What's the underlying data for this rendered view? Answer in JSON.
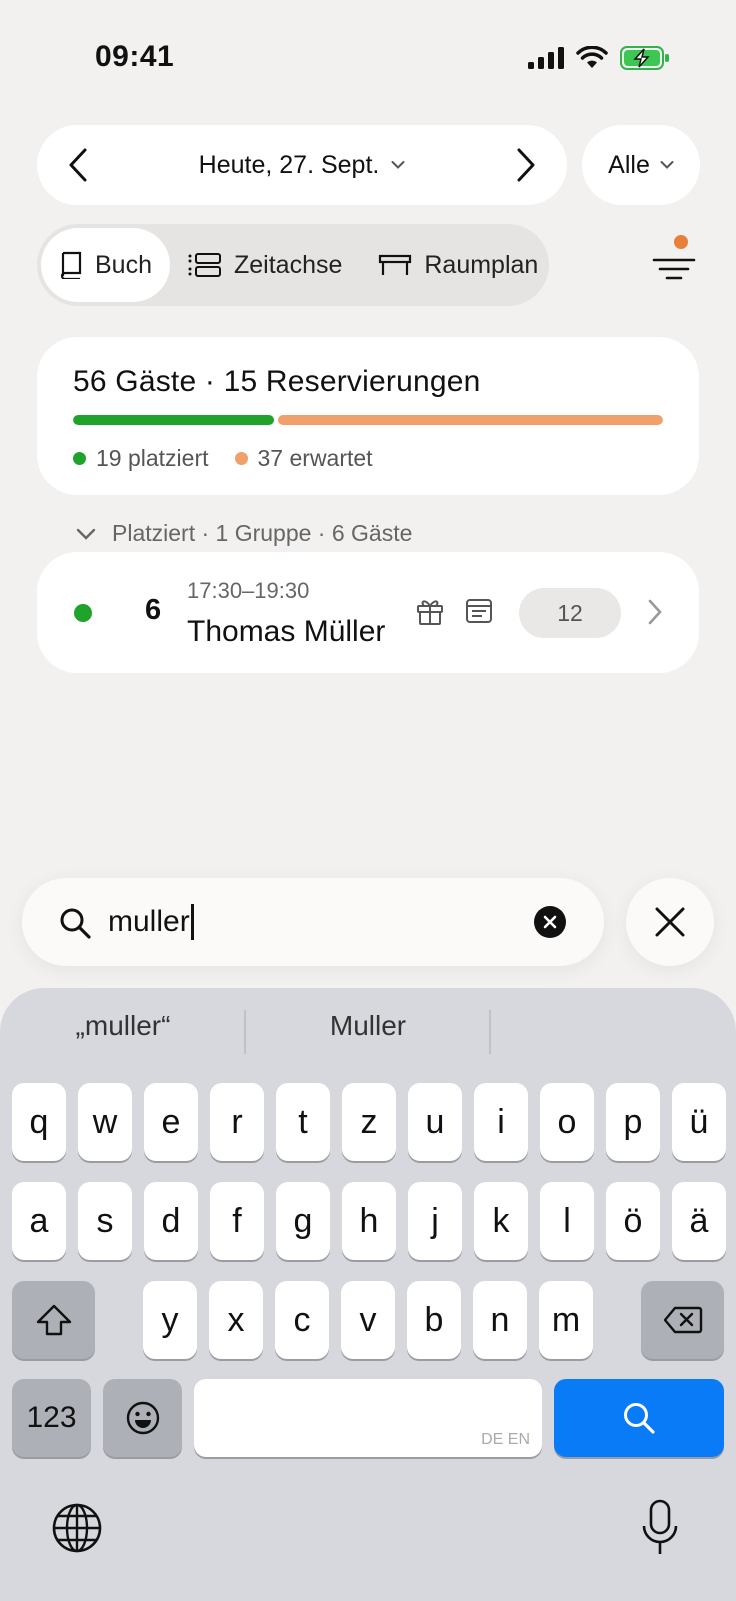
{
  "status_bar": {
    "time": "09:41"
  },
  "header": {
    "date_label": "Heute, 27. Sept.",
    "filter_label": "Alle"
  },
  "view_tabs": [
    {
      "label": "Buch",
      "active": true
    },
    {
      "label": "Zeitachse",
      "active": false
    },
    {
      "label": "Raumplan",
      "active": false
    }
  ],
  "summary": {
    "title": "56 Gäste · 15 Reservierungen",
    "placed_label": "19 platziert",
    "expected_label": "37 erwartet",
    "placed_fraction": 0.34,
    "colors": {
      "placed": "#1fa32a",
      "expected": "#f0a06a"
    }
  },
  "group": {
    "header": "Platziert · 1 Gruppe · 6 Gäste"
  },
  "reservation": {
    "party_size": "6",
    "time": "17:30–19:30",
    "name": "Thomas Müller",
    "table": "12"
  },
  "search": {
    "value": "muller"
  },
  "keyboard": {
    "suggestions": [
      "„muller“",
      "Muller"
    ],
    "row1": [
      "q",
      "w",
      "e",
      "r",
      "t",
      "z",
      "u",
      "i",
      "o",
      "p",
      "ü"
    ],
    "row2": [
      "a",
      "s",
      "d",
      "f",
      "g",
      "h",
      "j",
      "k",
      "l",
      "ö",
      "ä"
    ],
    "row3": [
      "y",
      "x",
      "c",
      "v",
      "b",
      "n",
      "m"
    ],
    "numbers_key": "123",
    "space_hint": "DE EN"
  }
}
